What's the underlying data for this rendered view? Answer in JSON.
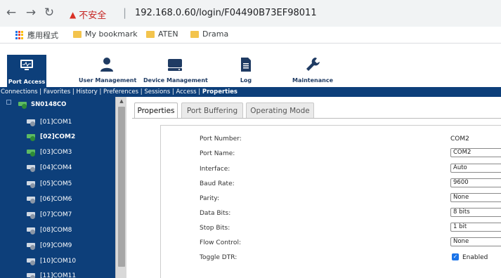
{
  "browser": {
    "security_label": "不安全",
    "url": "192.168.0.60/login/F04490B73EF98011",
    "bookmarks": [
      "應用程式",
      "My bookmark",
      "ATEN",
      "Drama"
    ]
  },
  "toolbar": {
    "items": [
      "Port Access",
      "User Management",
      "Device Management",
      "Log",
      "Maintenance"
    ]
  },
  "menu": {
    "items": [
      "Connections",
      "Favorites",
      "History",
      "Preferences",
      "Sessions",
      "Access",
      "Properties"
    ],
    "separator": " | "
  },
  "sidebar": {
    "root": "SN0148CO",
    "items": [
      {
        "label": "[01]COM1",
        "state": "gray"
      },
      {
        "label": "[02]COM2",
        "state": "green"
      },
      {
        "label": "[03]COM3",
        "state": "green"
      },
      {
        "label": "[04]COM4",
        "state": "gray"
      },
      {
        "label": "[05]COM5",
        "state": "gray"
      },
      {
        "label": "[06]COM6",
        "state": "gray"
      },
      {
        "label": "[07]COM7",
        "state": "gray"
      },
      {
        "label": "[08]COM8",
        "state": "gray"
      },
      {
        "label": "[09]COM9",
        "state": "gray"
      },
      {
        "label": "[10]COM10",
        "state": "gray"
      },
      {
        "label": "[11]COM11",
        "state": "gray"
      }
    ],
    "selected_index": 1
  },
  "tabs": [
    "Properties",
    "Port Buffering",
    "Operating Mode"
  ],
  "properties": {
    "port_number_label": "Port Number:",
    "port_number_value": "COM2",
    "port_name_label": "Port Name:",
    "port_name_value": "COM2",
    "interface_label": "Interface:",
    "interface_value": "Auto",
    "baud_rate_label": "Baud Rate:",
    "baud_rate_value": "9600",
    "parity_label": "Parity:",
    "parity_value": "None",
    "data_bits_label": "Data Bits:",
    "data_bits_value": "8 bits",
    "stop_bits_label": "Stop Bits:",
    "stop_bits_value": "1 bit",
    "flow_control_label": "Flow Control:",
    "flow_control_value": "None",
    "toggle_dtr_label": "Toggle DTR:",
    "toggle_dtr_value": "Enabled"
  },
  "colors": {
    "brand": "#0d3f7a",
    "status_active": "#5dbb63",
    "security_warning": "#c5221f"
  }
}
